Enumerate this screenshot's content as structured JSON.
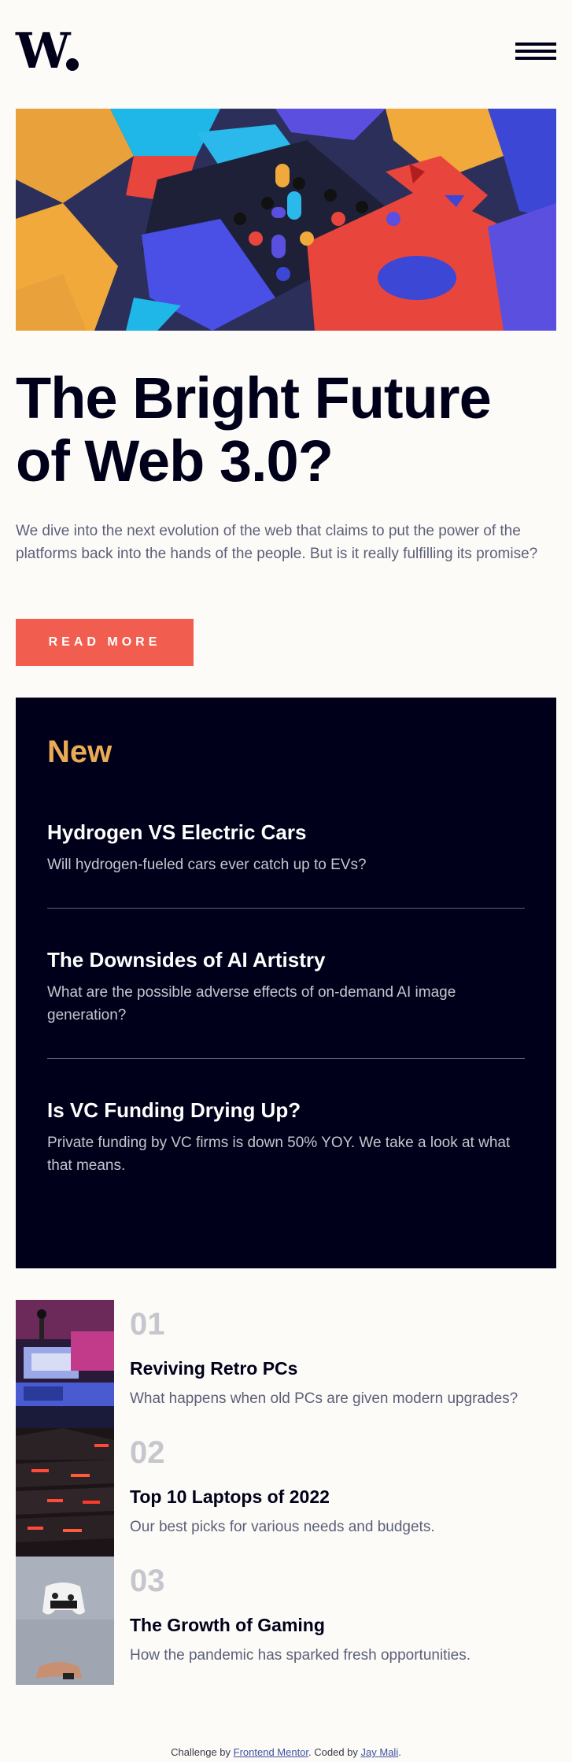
{
  "header": {
    "logo_text": "W",
    "menu_icon": "hamburger-icon"
  },
  "hero": {
    "image_alt": "abstract 3D blocks and shapes",
    "headline": "The Bright Future of Web 3.0?",
    "intro": "We dive into the next evolution of the web that claims to put the power of the platforms back into the hands of the people. But is it really fulfilling its promise?",
    "button_label": "READ MORE"
  },
  "new_panel": {
    "title": "New",
    "items": [
      {
        "title": "Hydrogen VS Electric Cars",
        "desc": "Will hydrogen-fueled cars ever catch up to EVs?"
      },
      {
        "title": "The Downsides of AI Artistry",
        "desc": "What are the possible adverse effects of on-demand AI image generation?"
      },
      {
        "title": "Is VC Funding Drying Up?",
        "desc": "Private funding by VC firms is down 50% YOY. We take a look at what that means."
      }
    ]
  },
  "articles": [
    {
      "num": "01",
      "title": "Reviving Retro PCs",
      "desc": "What happens when old PCs are given modern upgrades?"
    },
    {
      "num": "02",
      "title": "Top 10 Laptops of 2022",
      "desc": "Our best picks for various needs and budgets."
    },
    {
      "num": "03",
      "title": "The Growth of Gaming",
      "desc": "How the pandemic has sparked fresh opportunities."
    }
  ],
  "attribution": {
    "prefix": "Challenge by ",
    "link1": "Frontend Mentor",
    "middle": ". Coded by ",
    "link2": "Jay Mali",
    "suffix": "."
  },
  "colors": {
    "accent": "#f15e50",
    "new_title": "#e9ab53",
    "dark": "#00001a",
    "background": "#fcfbf7",
    "muted": "#5d5f79"
  }
}
